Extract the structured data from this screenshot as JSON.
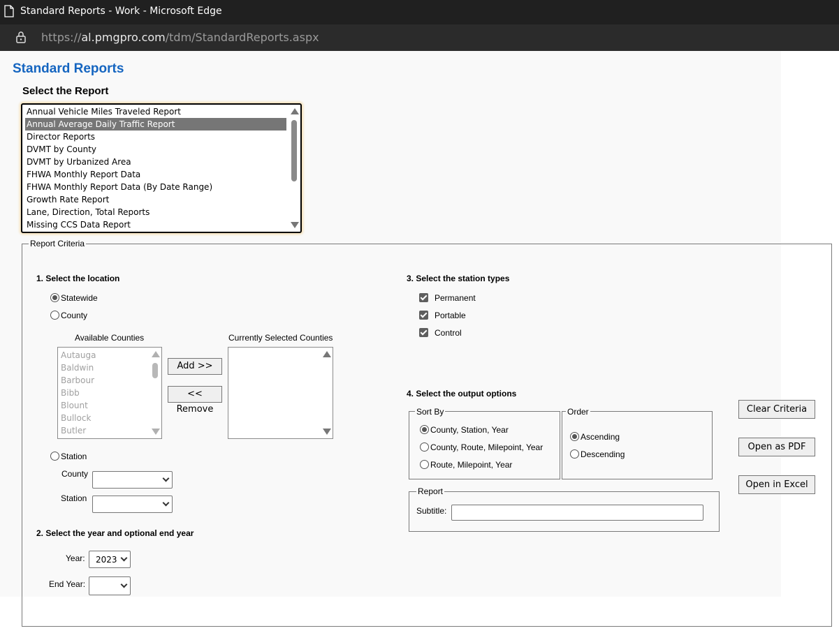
{
  "browser": {
    "window_title": "Standard Reports - Work - Microsoft Edge",
    "url_prefix": "https://",
    "url_host": "al.pmgpro.com",
    "url_path": "/tdm/StandardReports.aspx"
  },
  "page": {
    "title": "Standard Reports",
    "select_report_heading": "Select the Report",
    "reports": [
      "Annual Vehicle Miles Traveled Report",
      "Annual Average Daily Traffic Report",
      "Director Reports",
      "DVMT by County",
      "DVMT by Urbanized Area",
      "FHWA Monthly Report Data",
      "FHWA Monthly Report Data (By Date Range)",
      "Growth Rate Report",
      "Lane, Direction, Total Reports",
      "Missing CCS Data Report"
    ],
    "selected_report": "Annual Average Daily Traffic Report"
  },
  "criteria": {
    "legend": "Report Criteria",
    "location": {
      "heading": "1. Select the location",
      "statewide_label": "Statewide",
      "county_label": "County",
      "station_label": "Station",
      "selected": "Statewide",
      "available_heading": "Available Counties",
      "selected_heading": "Currently Selected Counties",
      "available_counties": [
        "Autauga",
        "Baldwin",
        "Barbour",
        "Bibb",
        "Blount",
        "Bullock",
        "Butler"
      ],
      "add_button": "Add >>",
      "remove_button": "<< Remove",
      "station_county_label": "County",
      "station_station_label": "Station"
    },
    "year": {
      "heading": "2. Select the year and optional end year",
      "year_label": "Year:",
      "year_value": "2023",
      "end_year_label": "End Year:"
    },
    "station_types": {
      "heading": "3. Select the station types",
      "permanent": "Permanent",
      "portable": "Portable",
      "control": "Control"
    },
    "output": {
      "heading": "4. Select the output options",
      "sort_by_legend": "Sort By",
      "sort_options": [
        "County, Station, Year",
        "County, Route, Milepoint, Year",
        "Route, Milepoint, Year"
      ],
      "order_legend": "Order",
      "order_options": [
        "Ascending",
        "Descending"
      ],
      "report_legend": "Report",
      "subtitle_label": "Subtitle:"
    },
    "buttons": {
      "clear": "Clear Criteria",
      "pdf": "Open as PDF",
      "excel": "Open in Excel"
    }
  }
}
